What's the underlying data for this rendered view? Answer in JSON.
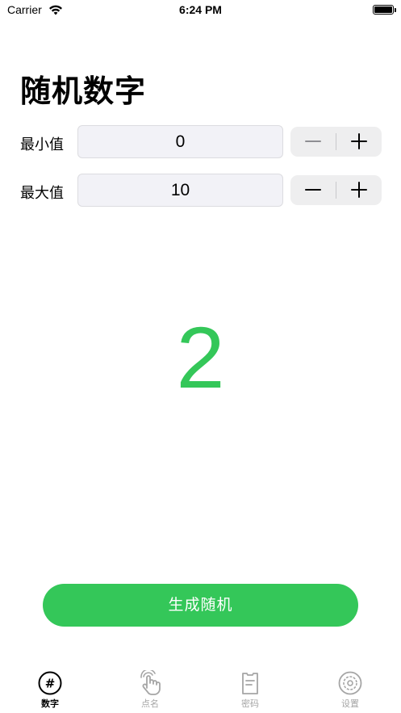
{
  "status_bar": {
    "carrier": "Carrier",
    "time": "6:24 PM"
  },
  "page": {
    "title": "随机数字"
  },
  "min_row": {
    "label": "最小值",
    "value": "0"
  },
  "max_row": {
    "label": "最大值",
    "value": "10"
  },
  "result": {
    "value": "2"
  },
  "generate_button": {
    "label": "生成随机"
  },
  "colors": {
    "accent": "#34c759",
    "field_bg": "#f2f2f7",
    "stepper_bg": "#eeeeef",
    "tab_inactive": "#a5a5a5"
  },
  "tabs": [
    {
      "label": "数字",
      "icon": "hash-icon",
      "active": true
    },
    {
      "label": "点名",
      "icon": "hand-pointer-icon",
      "active": false
    },
    {
      "label": "密码",
      "icon": "document-icon",
      "active": false
    },
    {
      "label": "设置",
      "icon": "gear-icon",
      "active": false
    }
  ]
}
